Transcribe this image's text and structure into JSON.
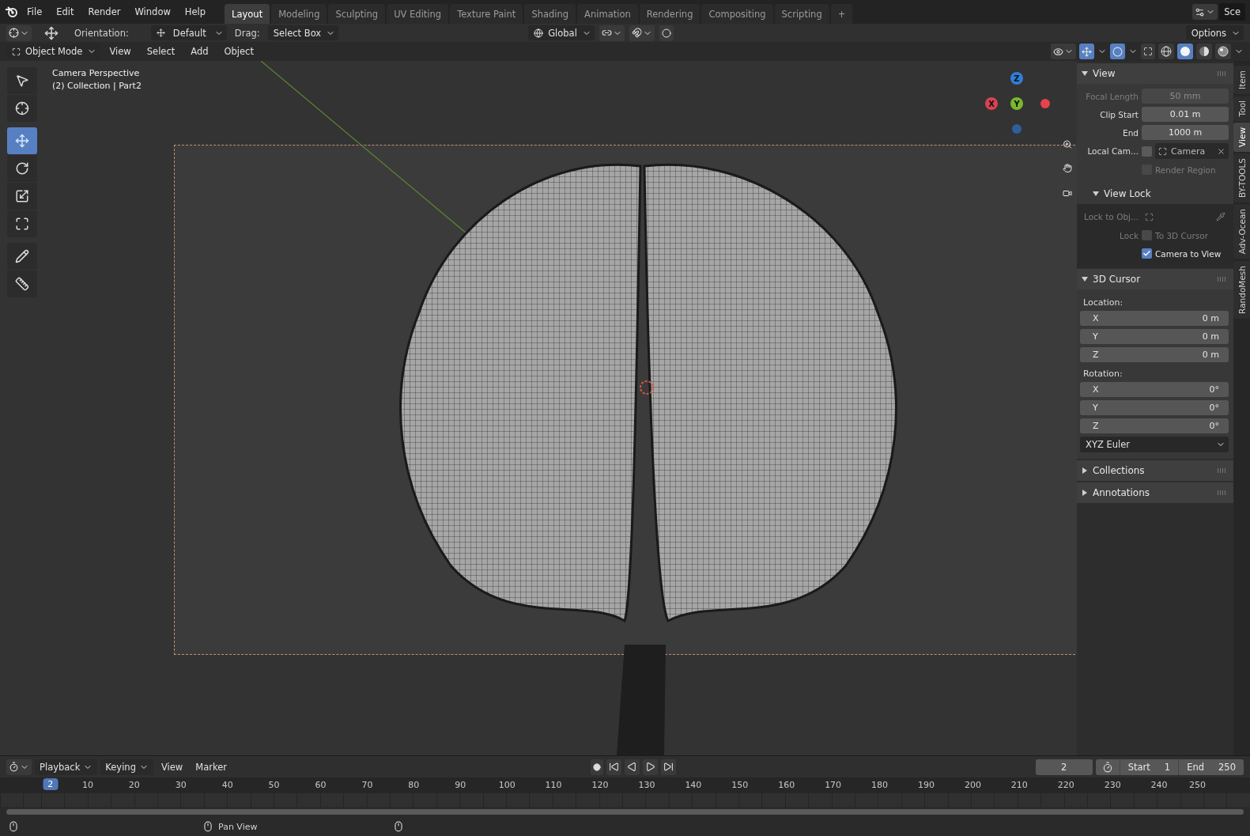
{
  "menu": [
    "File",
    "Edit",
    "Render",
    "Window",
    "Help"
  ],
  "workspaces": [
    {
      "label": "Layout",
      "selected": true
    },
    {
      "label": "Modeling",
      "selected": false
    },
    {
      "label": "Sculpting",
      "selected": false
    },
    {
      "label": "UV Editing",
      "selected": false
    },
    {
      "label": "Texture Paint",
      "selected": false
    },
    {
      "label": "Shading",
      "selected": false
    },
    {
      "label": "Animation",
      "selected": false
    },
    {
      "label": "Rendering",
      "selected": false
    },
    {
      "label": "Compositing",
      "selected": false
    },
    {
      "label": "Scripting",
      "selected": false
    }
  ],
  "add_workspace": "+",
  "scene_label": "Sce",
  "tool_header": {
    "orientation_label": "Orientation:",
    "orientation": "Default",
    "drag_label": "Drag:",
    "drag": "Select Box",
    "transform_orientation": "Global",
    "options": "Options"
  },
  "viewport_header": {
    "mode": "Object Mode",
    "menus": [
      "View",
      "Select",
      "Add",
      "Object"
    ],
    "shading": [
      {
        "kind": "wireframe",
        "selected": false
      },
      {
        "kind": "solid",
        "selected": true
      },
      {
        "kind": "material",
        "selected": false
      },
      {
        "kind": "rendered",
        "selected": false
      }
    ]
  },
  "toolbar": [
    {
      "kind": "select",
      "selected": false
    },
    {
      "kind": "cursor",
      "selected": false
    },
    {
      "kind": "move",
      "selected": true
    },
    {
      "kind": "rotate",
      "selected": false
    },
    {
      "kind": "scale",
      "selected": false
    },
    {
      "kind": "transform",
      "selected": false
    },
    {
      "kind": "annotate",
      "selected": false
    },
    {
      "kind": "measure",
      "selected": false
    }
  ],
  "viewport": {
    "title": "Camera Perspective",
    "collection": "(2) Collection | Part2",
    "gizmo_axes": [
      "Z",
      "Y",
      "X"
    ]
  },
  "view_panel": {
    "title": "View",
    "expanded": true,
    "rows": [
      {
        "kind": "field",
        "label": "Focal Length",
        "value": "50 mm",
        "disabled": true
      },
      {
        "kind": "field",
        "label": "Clip Start",
        "value": "0.01 m",
        "disabled": false
      },
      {
        "kind": "field",
        "label": "End",
        "value": "1000 m",
        "disabled": false
      },
      {
        "kind": "camera",
        "label": "Local Cam...",
        "checked": false,
        "value": "Camera",
        "disabled": false
      },
      {
        "kind": "checkbox",
        "text": "Render Region",
        "checked": false,
        "disabled": true
      }
    ],
    "view_lock": {
      "title": "View Lock",
      "expanded": true,
      "rows": [
        {
          "kind": "object",
          "label": "Lock to Obj...",
          "disabled": true
        },
        {
          "kind": "checkbox",
          "label": "Lock",
          "text": "To 3D Cursor",
          "checked": false,
          "disabled": true
        },
        {
          "kind": "checkbox",
          "text": "Camera to View",
          "checked": true,
          "disabled": false
        }
      ]
    }
  },
  "cursor_panel": {
    "title": "3D Cursor",
    "expanded": true,
    "location_label": "Location:",
    "location": [
      {
        "axis": "X",
        "value": "0 m"
      },
      {
        "axis": "Y",
        "value": "0 m"
      },
      {
        "axis": "Z",
        "value": "0 m"
      }
    ],
    "rotation_label": "Rotation:",
    "rotation": [
      {
        "axis": "X",
        "value": "0°"
      },
      {
        "axis": "Y",
        "value": "0°"
      },
      {
        "axis": "Z",
        "value": "0°"
      }
    ],
    "rotation_mode": "XYZ Euler"
  },
  "collapsed_panels": [
    {
      "title": "Collections",
      "expanded": false
    },
    {
      "title": "Annotations",
      "expanded": false
    }
  ],
  "sidebar_tabs": [
    {
      "label": "Item",
      "selected": false
    },
    {
      "label": "Tool",
      "selected": false
    },
    {
      "label": "View",
      "selected": true
    },
    {
      "label": "BY-TOOLS",
      "selected": false
    },
    {
      "label": "Adv-Ocean",
      "selected": false
    },
    {
      "label": "RandoMesh",
      "selected": false
    }
  ],
  "timeline": {
    "menus": [
      {
        "label": "Playback",
        "dropdown": true
      },
      {
        "label": "Keying",
        "dropdown": true
      },
      {
        "label": "View",
        "dropdown": false
      },
      {
        "label": "Marker",
        "dropdown": false
      }
    ],
    "current_frame": "2",
    "start_label": "Start",
    "start": "1",
    "end_label": "End",
    "end": "250",
    "ticks": [
      "10",
      "20",
      "30",
      "40",
      "50",
      "60",
      "70",
      "80",
      "90",
      "100",
      "110",
      "120",
      "130",
      "140",
      "150",
      "160",
      "170",
      "180",
      "190",
      "200",
      "210",
      "220",
      "230",
      "240",
      "250"
    ],
    "playhead": {
      "label": "2",
      "level": 0.008
    }
  },
  "status_bar": {
    "hint": "Pan View"
  }
}
